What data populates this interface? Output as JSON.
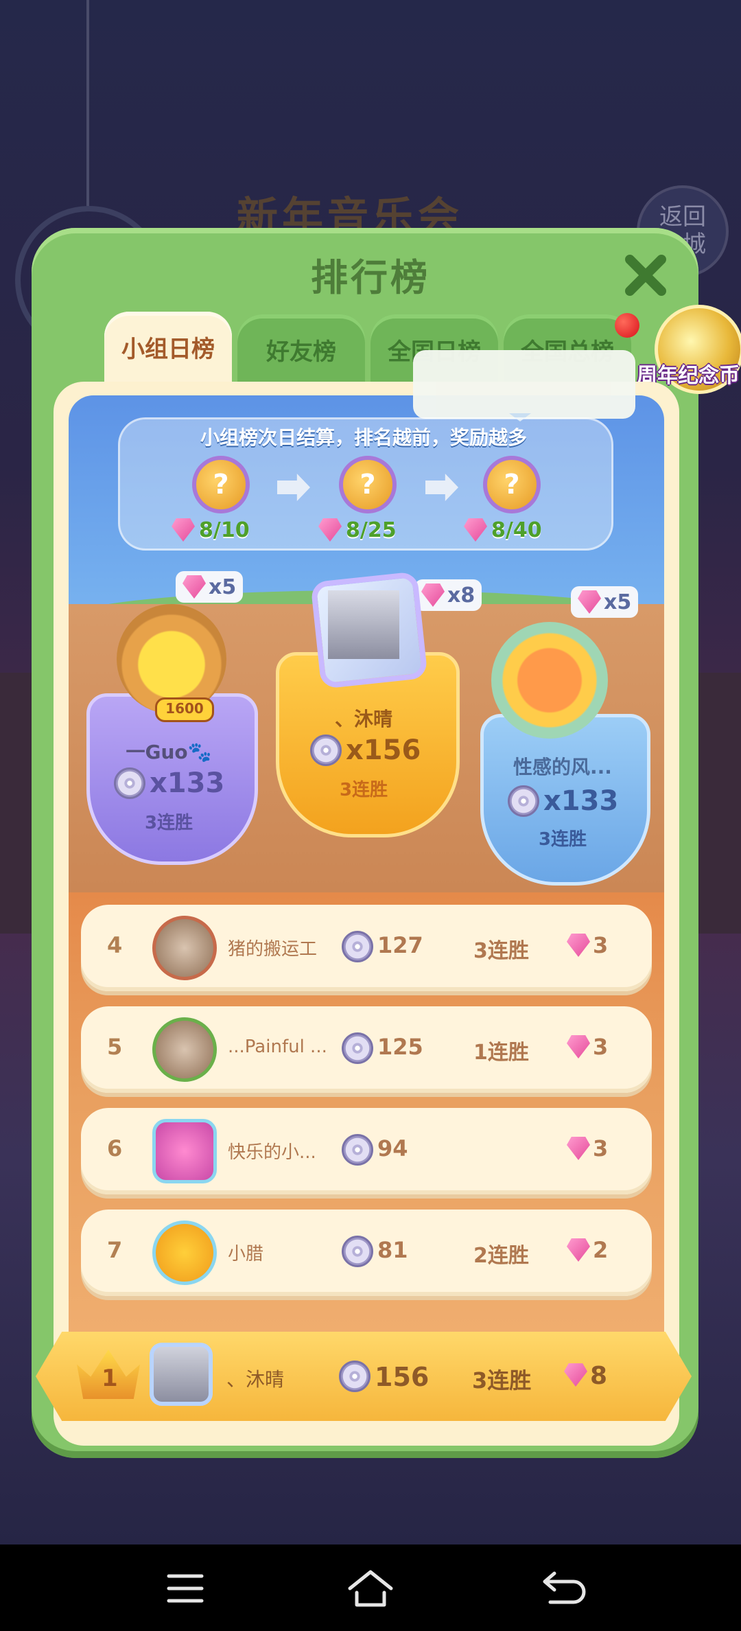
{
  "background": {
    "event_title": "新年音乐会",
    "back_button": "返回\n主城"
  },
  "panel": {
    "title": "排行榜",
    "tabs": [
      {
        "label": "小组日榜",
        "active": true
      },
      {
        "label": "好友榜",
        "active": false
      },
      {
        "label": "全国日榜",
        "active": false
      },
      {
        "label": "全国总榜",
        "active": false
      }
    ],
    "coin_label": "周年纪念币"
  },
  "rewards": {
    "title": "小组榜次日结算，排名越前，奖励越多",
    "items": [
      {
        "count": "8/10"
      },
      {
        "count": "8/25"
      },
      {
        "count": "8/40"
      }
    ]
  },
  "podium": {
    "first": {
      "name": "、沐晴",
      "score": "x156",
      "streak": "3连胜",
      "gems": "x8"
    },
    "second": {
      "name": "一Guo🐾",
      "score": "x133",
      "streak": "3连胜",
      "gems": "x5",
      "badge": "1600"
    },
    "third": {
      "name": "性感的风...",
      "score": "x133",
      "streak": "3连胜",
      "gems": "x5"
    }
  },
  "list": [
    {
      "rank": "4",
      "name": "猪的搬运工",
      "score": "127",
      "streak": "3连胜",
      "gems": "3"
    },
    {
      "rank": "5",
      "name": "...Painful ...",
      "score": "125",
      "streak": "1连胜",
      "gems": "3"
    },
    {
      "rank": "6",
      "name": "快乐的小...",
      "score": "94",
      "streak": "",
      "gems": "3"
    },
    {
      "rank": "7",
      "name": "小腊",
      "score": "81",
      "streak": "2连胜",
      "gems": "2"
    }
  ],
  "me": {
    "rank": "1",
    "name": "、沐晴",
    "score": "156",
    "streak": "3连胜",
    "gems": "8"
  },
  "colors": {
    "panel": "#85c66a",
    "accent": "#f6b63c",
    "gem": "#e54a9a"
  }
}
